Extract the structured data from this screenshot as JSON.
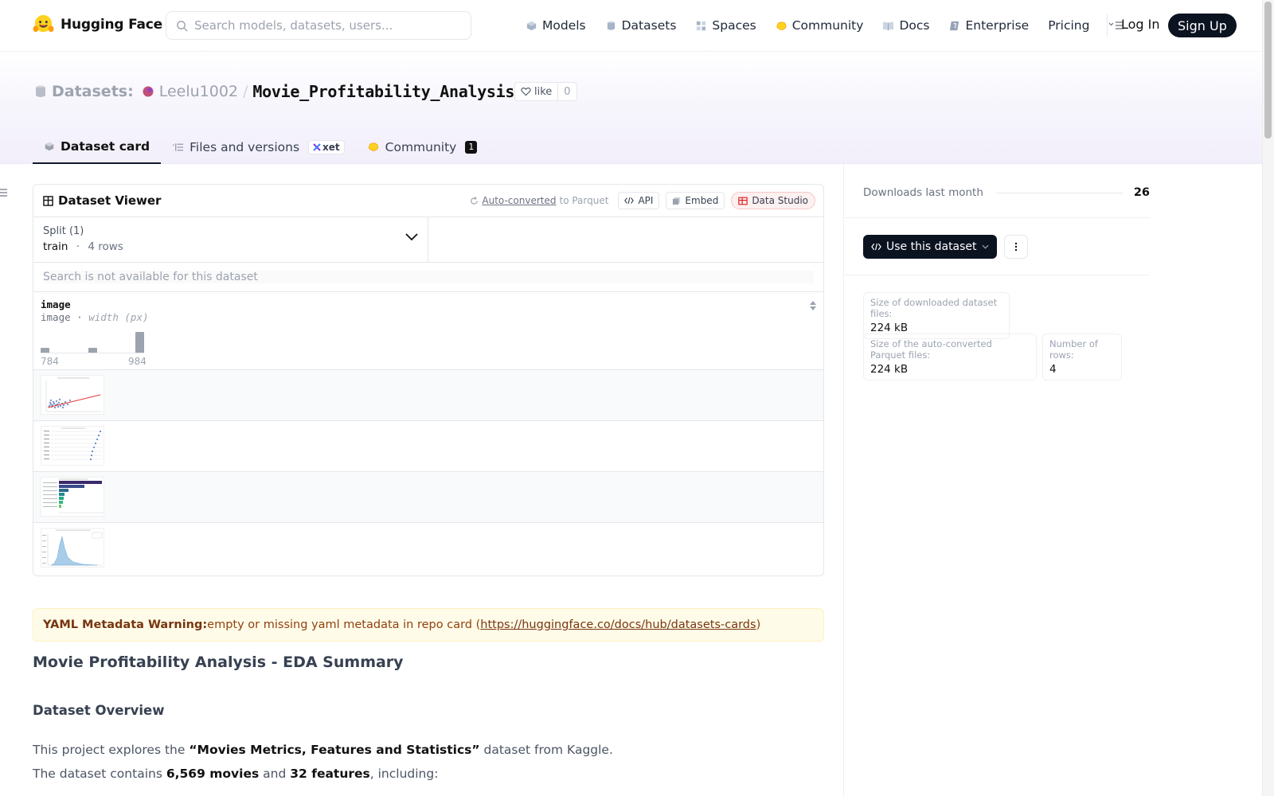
{
  "nav": {
    "brand": "Hugging Face",
    "search_placeholder": "Search models, datasets, users...",
    "links": [
      {
        "label": "Models",
        "icon": "models-icon"
      },
      {
        "label": "Datasets",
        "icon": "datasets-icon"
      },
      {
        "label": "Spaces",
        "icon": "spaces-icon"
      },
      {
        "label": "Community",
        "icon": "community-icon"
      },
      {
        "label": "Docs",
        "icon": "docs-icon"
      },
      {
        "label": "Enterprise",
        "icon": "enterprise-icon"
      },
      {
        "label": "Pricing",
        "icon": ""
      }
    ],
    "login": "Log In",
    "signup": "Sign Up"
  },
  "header": {
    "section": "Datasets:",
    "user": "Leelu1002",
    "separator": "/",
    "repo": "Movie_Profitability_Analysis",
    "like_label": "like",
    "like_count": "0",
    "tabs": {
      "card": "Dataset card",
      "files": "Files and versions",
      "xet": "xet",
      "community": "Community",
      "community_count": "1"
    }
  },
  "viewer": {
    "title": "Dataset Viewer",
    "auto_link": "Auto-converted",
    "auto_rest": " to Parquet",
    "api": "API",
    "embed": "Embed",
    "studio": "Data Studio",
    "split_label": "Split (1)",
    "split_value": "train",
    "split_dot": "·",
    "split_rows": "4 rows",
    "search_placeholder": "Search is not available for this dataset",
    "column": {
      "name": "image",
      "type": "image",
      "type_dot": "·",
      "type_detail": "width (px)",
      "min": "784",
      "max": "984",
      "histogram": [
        1,
        1,
        2
      ]
    }
  },
  "card": {
    "warning_bold": "YAML Metadata Warning:",
    "warning_text": " empty or missing yaml metadata in repo card (",
    "warning_link": "https://huggingface.co/docs/hub/datasets-cards",
    "warning_close": ")",
    "h2": "Movie Profitability Analysis - EDA Summary",
    "h3": "Dataset Overview",
    "p1_a": "This project explores the ",
    "p1_b": "“Movies Metrics, Features and Statistics”",
    "p1_c": " dataset from Kaggle.",
    "p2_a": "The dataset contains ",
    "p2_b": "6,569 movies",
    "p2_c": " and ",
    "p2_d": "32 features",
    "p2_e": ", including:"
  },
  "sidebar": {
    "downloads_label": "Downloads last month",
    "downloads_value": "26",
    "use_button": "Use this dataset",
    "stats": [
      {
        "label": "Size of downloaded dataset files:",
        "value": "224 kB"
      },
      {
        "label": "Size of the auto-converted Parquet files:",
        "value": "224 kB"
      },
      {
        "label": "Number of rows:",
        "value": "4"
      }
    ]
  }
}
